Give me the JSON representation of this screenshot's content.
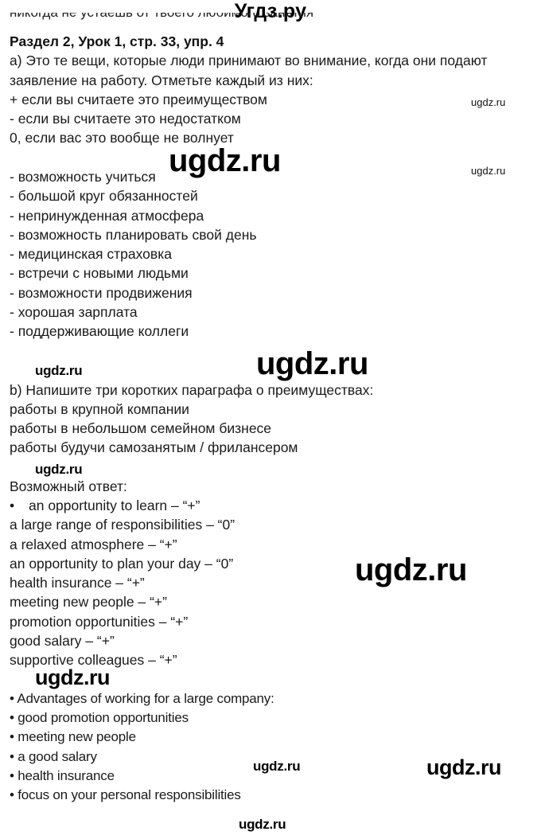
{
  "header": {
    "site_title": "Угдз.ру"
  },
  "document": {
    "cut_off_line": "никогда не устаёшь от твоего любимого занятия",
    "heading": "Раздел 2, Урок 1, стр. 33, упр. 4",
    "task_a": {
      "intro_lines": [
        "a) Это те вещи, которые люди принимают во внимание, когда они подают",
        "заявление на работу. Отметьте каждый из них:"
      ],
      "legend": [
        "+ если вы считаете это преимуществом",
        "- если вы считаете это недостатком",
        "0, если вас это вообще не волнует"
      ],
      "items": [
        "- возможность учиться",
        "- большой круг обязанностей",
        "- непринужденная атмосфера",
        "- возможность планировать свой день",
        "- медицинская страховка",
        "- встречи с новыми людьми",
        "- возможности продвижения",
        "- хорошая зарплата",
        "- поддерживающие коллеги"
      ]
    },
    "task_b": {
      "intro": "b) Напишите три коротких параграфа о преимуществах:",
      "topics": [
        "работы в крупной компании",
        "работы в небольшом семейном бизнесе",
        "работы будучи самозанятым / фрилансером"
      ]
    },
    "answer": {
      "label": "Возможный ответ:",
      "first_bullet": "•",
      "ratings": [
        "an opportunity to learn – “+”",
        "a large range of responsibilities – “0”",
        "a relaxed atmosphere – “+”",
        "an opportunity to plan your day – “0”",
        "health insurance – “+”",
        "meeting new people – “+”",
        "promotion opportunities – “+”",
        "good salary – “+”",
        "supportive colleagues – “+”"
      ],
      "advantages": [
        "• Advantages of working for a large company:",
        "• good promotion opportunities",
        "• meeting new people",
        "• a good salary",
        "• health insurance",
        "• focus on your personal responsibilities"
      ]
    }
  },
  "watermarks": {
    "text": "ugdz.ru"
  }
}
